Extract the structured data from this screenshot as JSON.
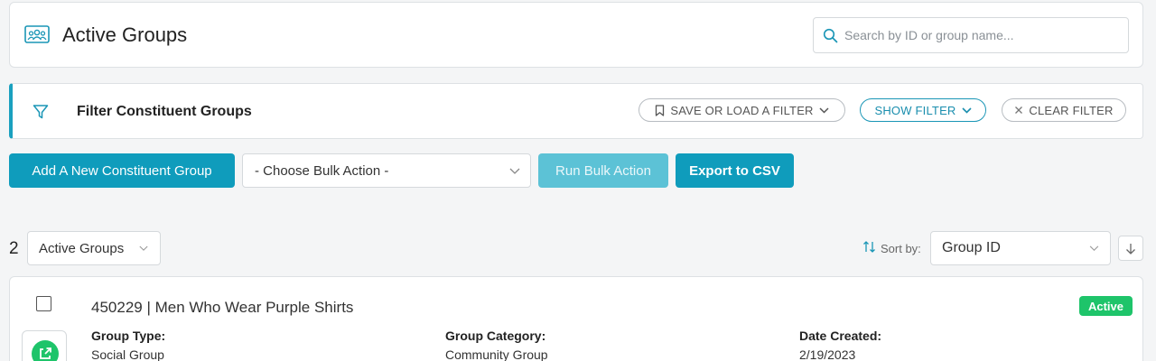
{
  "header": {
    "title": "Active Groups",
    "search_placeholder": "Search by ID or group name..."
  },
  "filter": {
    "title": "Filter Constituent Groups",
    "save_load_label": "SAVE OR LOAD A FILTER",
    "show_label": "SHOW FILTER",
    "clear_label": "CLEAR FILTER"
  },
  "actions": {
    "add_label": "Add A New Constituent Group",
    "bulk_select_value": "- Choose Bulk Action -",
    "run_bulk_label": "Run Bulk Action",
    "export_label": "Export to CSV"
  },
  "list": {
    "count": "2",
    "view_value": "Active Groups",
    "sort_label": "Sort by:",
    "sort_value": "Group ID"
  },
  "groups": [
    {
      "title": "450229 | Men Who Wear Purple Shirts",
      "status": "Active",
      "type_label": "Group Type:",
      "type_value": "Social Group",
      "category_label": "Group Category:",
      "category_value": "Community Group",
      "created_label": "Date Created:",
      "created_value": "2/19/2023"
    }
  ],
  "colors": {
    "primary": "#0f9cbc",
    "primary_disabled": "#5cc2d6",
    "active_badge": "#1ec46a"
  },
  "icons": [
    "group-icon",
    "search-icon",
    "funnel-icon",
    "bookmark-icon",
    "chevron-down-icon",
    "close-icon",
    "sort-icon",
    "arrow-down-icon",
    "external-link-icon"
  ]
}
